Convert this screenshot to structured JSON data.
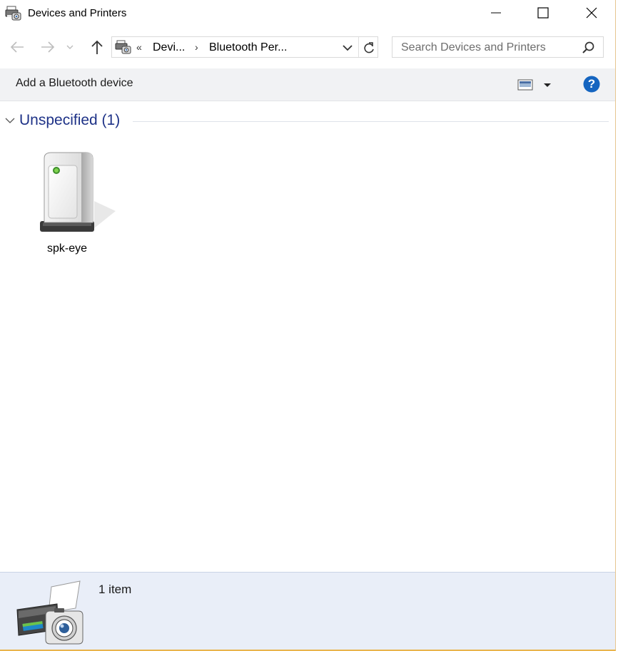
{
  "window": {
    "title": "Devices and Printers"
  },
  "address_bar": {
    "overflow_chevron": "«",
    "crumbs": [
      "Devi...",
      "Bluetooth Per..."
    ],
    "separator": "›"
  },
  "search": {
    "placeholder": "Search Devices and Printers"
  },
  "command_bar": {
    "add_device_label": "Add a Bluetooth device",
    "help_glyph": "?"
  },
  "group": {
    "label": "Unspecified (1)"
  },
  "devices": [
    {
      "label": "spk-eye",
      "icon": "generic-device-icon"
    }
  ],
  "details": {
    "count": "1 item",
    "icon": "devices-and-printers-icon"
  },
  "colors": {
    "group_header": "#1e3287",
    "help_button": "#1565c0",
    "details_background": "#e9eef8",
    "command_bar_background": "#f1f2f4"
  }
}
